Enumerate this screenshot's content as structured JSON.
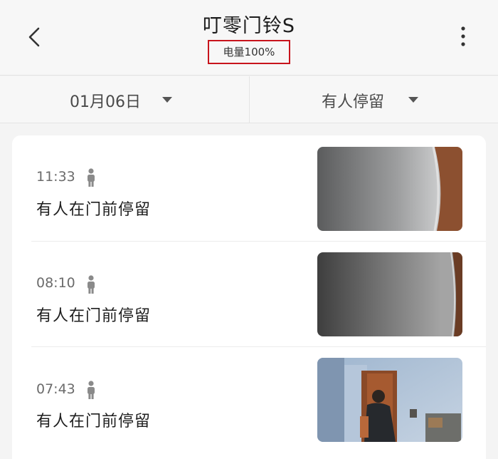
{
  "header": {
    "title": "叮零门铃S",
    "battery": "电量100%",
    "back_icon": "chevron-left-icon",
    "more_icon": "more-vertical-icon"
  },
  "filters": {
    "date": "01月06日",
    "type": "有人停留"
  },
  "events": [
    {
      "time": "11:33",
      "description": "有人在门前停留",
      "icon": "person-icon"
    },
    {
      "time": "08:10",
      "description": "有人在门前停留",
      "icon": "person-icon"
    },
    {
      "time": "07:43",
      "description": "有人在门前停留",
      "icon": "person-icon"
    }
  ],
  "colors": {
    "highlight_border": "#c8141c",
    "background": "#f4f4f4",
    "card": "#ffffff"
  }
}
